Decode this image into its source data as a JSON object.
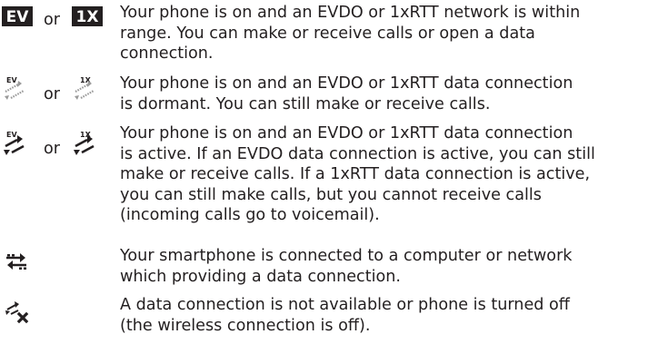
{
  "rows": [
    {
      "icons": [
        "ev-network-icon",
        "1x-network-icon"
      ],
      "joiner": "or",
      "lines": [
        "Your phone is on and an EVDO or 1xRTT network is within",
        "range. You can make or receive calls or open a data",
        "connection."
      ]
    },
    {
      "icons": [
        "ev-dormant-data-icon",
        "1x-dormant-data-icon"
      ],
      "joiner": "or",
      "lines": [
        "Your phone is on and an EVDO or 1xRTT data connection",
        "is dormant. You can still make or receive calls."
      ]
    },
    {
      "icons": [
        "ev-active-data-icon",
        "1x-active-data-icon"
      ],
      "joiner": "or",
      "lines": [
        "Your phone is on and an EVDO or 1xRTT data connection",
        "is active. If an EVDO data connection is active, you can still",
        "make or receive calls. If a 1xRTT data connection is active,",
        "you can still make calls, but you cannot receive calls",
        "(incoming calls go to voicemail)."
      ]
    },
    {
      "icons": [
        "smartphone-connected-icon"
      ],
      "lines": [
        "Your smartphone is connected to a computer or network",
        "which providing a data connection."
      ]
    },
    {
      "icons": [
        "data-unavailable-icon"
      ],
      "lines": [
        "A data connection is not available or phone is turned off",
        "(the wireless connection is off)."
      ]
    }
  ],
  "badges": {
    "ev": "EV",
    "1x": "1X"
  }
}
